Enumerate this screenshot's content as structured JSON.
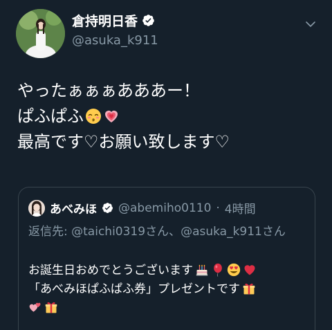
{
  "author": {
    "display_name": "倉持明日香",
    "handle": "@asuka_k911",
    "verified": true
  },
  "tweet": {
    "lines": [
      "やったぁぁぁあああー！",
      "ぱふぱふ",
      "最高です♡お願い致します♡"
    ],
    "line2_emojis": [
      "kissing-face-emoji",
      "growing-heart-emoji"
    ]
  },
  "quoted": {
    "display_name": "あべみほ",
    "handle": "@abemiho0110",
    "separator": "·",
    "time": "4時間",
    "reply_prefix": "返信先: ",
    "reply_mention_1": "@taichi0319",
    "reply_between": "さん、",
    "reply_mention_2": "@asuka_k911",
    "reply_suffix": "さん",
    "body_line1": "お誕生日おめでとうございます",
    "body_line1_emojis": [
      "birthday-cake-emoji",
      "balloon-emoji",
      "heart-eyes-emoji",
      "red-heart-emoji"
    ],
    "body_line2": "「あべみほぱふぱふ券」プレゼントです",
    "body_line2_emojis": [
      "gift-emoji"
    ],
    "body_line3_emojis": [
      "two-hearts-emoji",
      "gift-emoji"
    ]
  },
  "colors": {
    "background": "#15202b",
    "secondary_text": "#8899a6",
    "border": "#38444d",
    "verified_badge": "#ffffff"
  }
}
